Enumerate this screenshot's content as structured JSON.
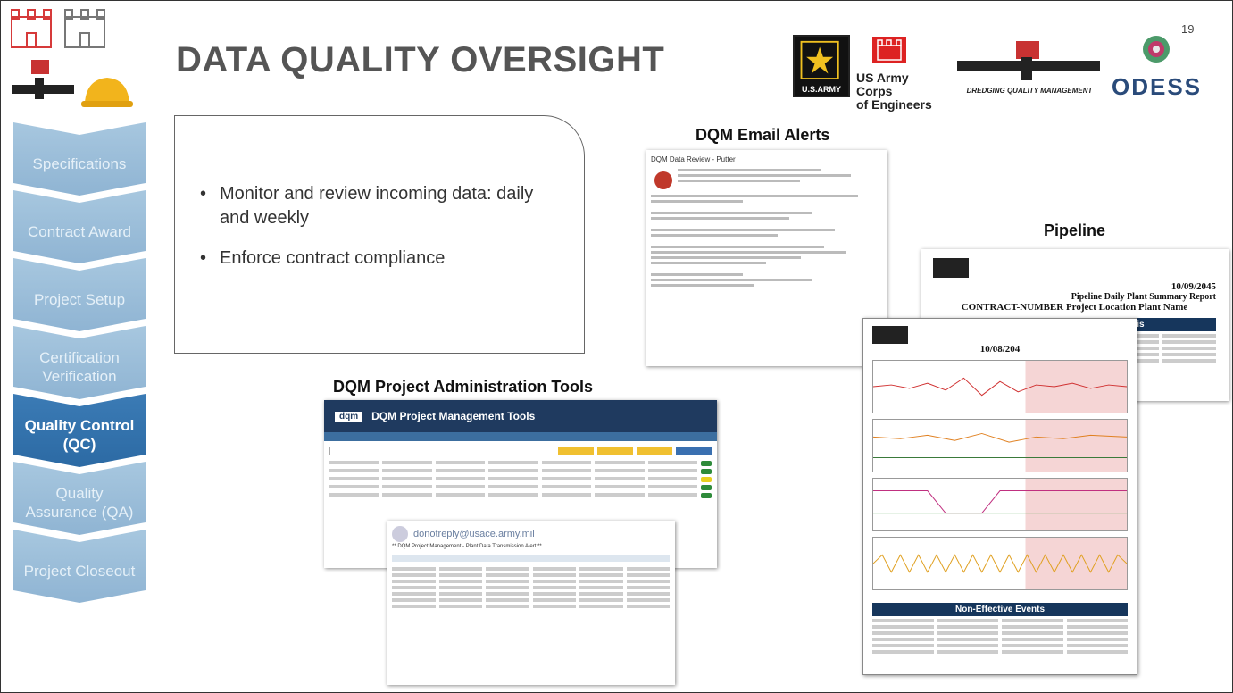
{
  "slide": {
    "title": "DATA QUALITY OVERSIGHT",
    "page_number": "19"
  },
  "sidebar": {
    "items": [
      {
        "label": "Specifications",
        "active": false
      },
      {
        "label": "Contract Award",
        "active": false
      },
      {
        "label": "Project Setup",
        "active": false
      },
      {
        "label": "Certification Verification",
        "active": false
      },
      {
        "label": "Quality Control (QC)",
        "active": true
      },
      {
        "label": "Quality Assurance (QA)",
        "active": false
      },
      {
        "label": "Project Closeout",
        "active": false
      }
    ]
  },
  "logos": {
    "army_text": "U.S.ARMY",
    "usace_line1": "US Army Corps",
    "usace_line2": "of Engineers",
    "dqm_text": "DREDGING QUALITY MANAGEMENT",
    "odess_text": "ODESS"
  },
  "bullets": [
    "Monitor and review incoming data: daily and weekly",
    "Enforce contract compliance"
  ],
  "sections": {
    "email_label": "DQM Email Alerts",
    "pipeline_label": "Pipeline",
    "tools_label": "DQM Project Administration Tools"
  },
  "email": {
    "header": "DQM Data Review - Putter"
  },
  "tools_shot": {
    "header": "DQM Project Management Tools"
  },
  "note_shot": {
    "from": "donotreply@usace.army.mil",
    "subject": "** DQM Project Management - Plant Data Transmission Alert **"
  },
  "pipeline_report": {
    "date": "10/09/2045",
    "title": "Pipeline Daily Plant Summary Report",
    "subtitle": "CONTRACT-NUMBER Project Location Plant Name",
    "summary": "Summary Report - Time Analysis"
  },
  "pipeline_chart": {
    "date": "10/08/204",
    "events": "Non-Effective Events"
  },
  "colors": {
    "nav_active": "#2c6aa4",
    "nav_light": "#9dbfdc",
    "title": "#555555",
    "report_header": "#16365c"
  }
}
